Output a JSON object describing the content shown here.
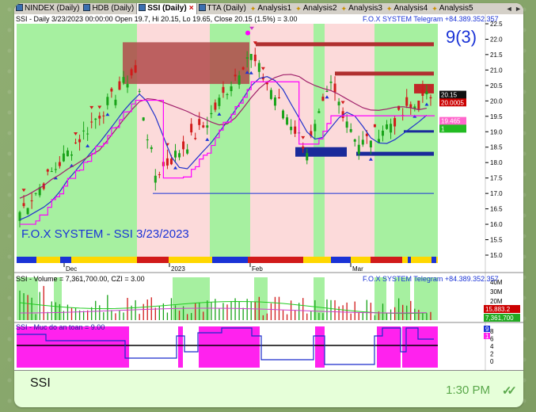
{
  "tabs": [
    {
      "label": "NINDEX (Daily)",
      "icon": "chart-icon",
      "active": false
    },
    {
      "label": "HDB (Daily)",
      "icon": "chart-icon",
      "active": false
    },
    {
      "label": "SSI (Daily)",
      "icon": "chart-icon",
      "active": true
    },
    {
      "label": "TTA (Daily)",
      "icon": "chart-icon",
      "active": false
    },
    {
      "label": "Analysis1",
      "icon": "analysis-icon",
      "active": false
    },
    {
      "label": "Analysis2",
      "icon": "analysis-icon",
      "active": false
    },
    {
      "label": "Analysis3",
      "icon": "analysis-icon",
      "active": false
    },
    {
      "label": "Analysis4",
      "icon": "analysis-icon",
      "active": false
    },
    {
      "label": "Analysis5",
      "icon": "analysis-icon",
      "active": false
    }
  ],
  "close_tab_glyph": "×",
  "tab_nav_glyphs": "◄ ►",
  "price_panel": {
    "title_left": "SSI - Daily 3/23/2023 00:00:00 Open 19.7, Hi 20.15, Lo 19.65, Close 20.15 (1.5%)  = 3.00",
    "title_right": "F.O.X SYSTEM Telegram +84.389.352.357",
    "overlay_label": "9(3)",
    "watermark": "F.O.X SYSTEM - SSI 3/23/2023",
    "y_ticks": [
      "22.5",
      "22.0",
      "21.5",
      "21.0",
      "20.5",
      "20.0",
      "19.5",
      "19.0",
      "18.5",
      "18.0",
      "17.5",
      "17.0",
      "16.5",
      "16.0",
      "15.5",
      "15.0"
    ],
    "x_ticks": [
      "Dec",
      "2023",
      "Feb",
      "Mar"
    ],
    "tags": {
      "close": "20.15",
      "line_a": "20.0005",
      "line_b": "19.465",
      "small": "1"
    }
  },
  "volume_panel": {
    "title_left": "SSI - Volume = 7,361,700.00, CZI = 3.00",
    "title_right": "F.O.X SYSTEM Telegram +84.389.352.357",
    "y_ticks": [
      "40M",
      "30M",
      "20M",
      "10M"
    ],
    "tags": {
      "a": "15,883.2",
      "b": "7,361,700"
    }
  },
  "safety_panel": {
    "title_left": "SSI - Muc do an toan = 9.00",
    "y_ticks": [
      "8",
      "6",
      "4",
      "2",
      "0"
    ],
    "tags": {
      "a": "9",
      "b": "1"
    }
  },
  "colors": {
    "up": "#19a319",
    "down": "#d11a1a",
    "green_zone": "#a6f0a0",
    "red_zone": "#fcdada",
    "accent_blue": "#1a33d6",
    "magenta": "#ff00ff"
  },
  "message": {
    "text": "SSI",
    "time": "1:30 PM",
    "status": "double-check-icon"
  }
}
